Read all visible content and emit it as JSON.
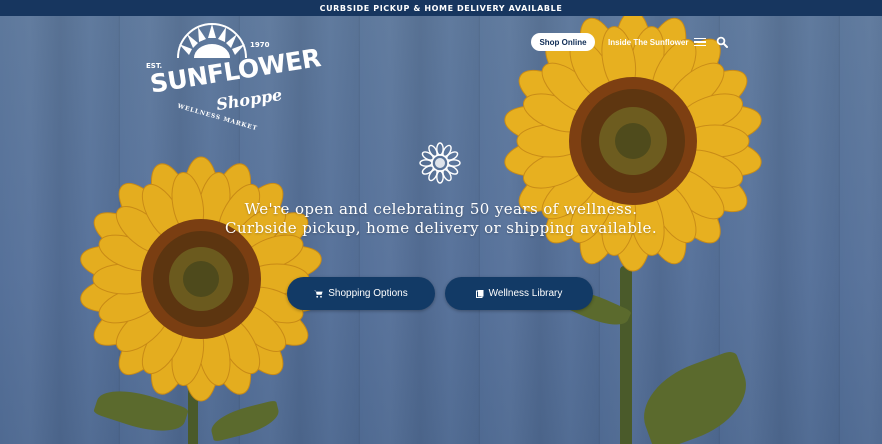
{
  "promo_bar": {
    "text": "CURBSIDE PICKUP & HOME DELIVERY AVAILABLE"
  },
  "logo": {
    "est": "EST.",
    "year": "1970",
    "name_main": "SUNFLOWER",
    "name_script": "Shoppe",
    "tagline": "WELLNESS MARKET"
  },
  "header": {
    "shop_online_label": "Shop Online",
    "inside_label": "Inside The Sunflower",
    "menu_icon": "hamburger-icon",
    "search_icon": "search-icon"
  },
  "hero": {
    "headline_line1": "We're open and celebrating 50 years of wellness.",
    "headline_line2": "Curbside pickup, home delivery or shipping available.",
    "buttons": [
      {
        "label": "Shopping Options",
        "icon": "cart-icon"
      },
      {
        "label": "Wellness Library",
        "icon": "book-icon"
      }
    ]
  },
  "colors": {
    "navy": "#17365f",
    "button": "#123a66",
    "background": "#5b7599",
    "petal": "#e8b21f",
    "center": "#6b3a14"
  }
}
